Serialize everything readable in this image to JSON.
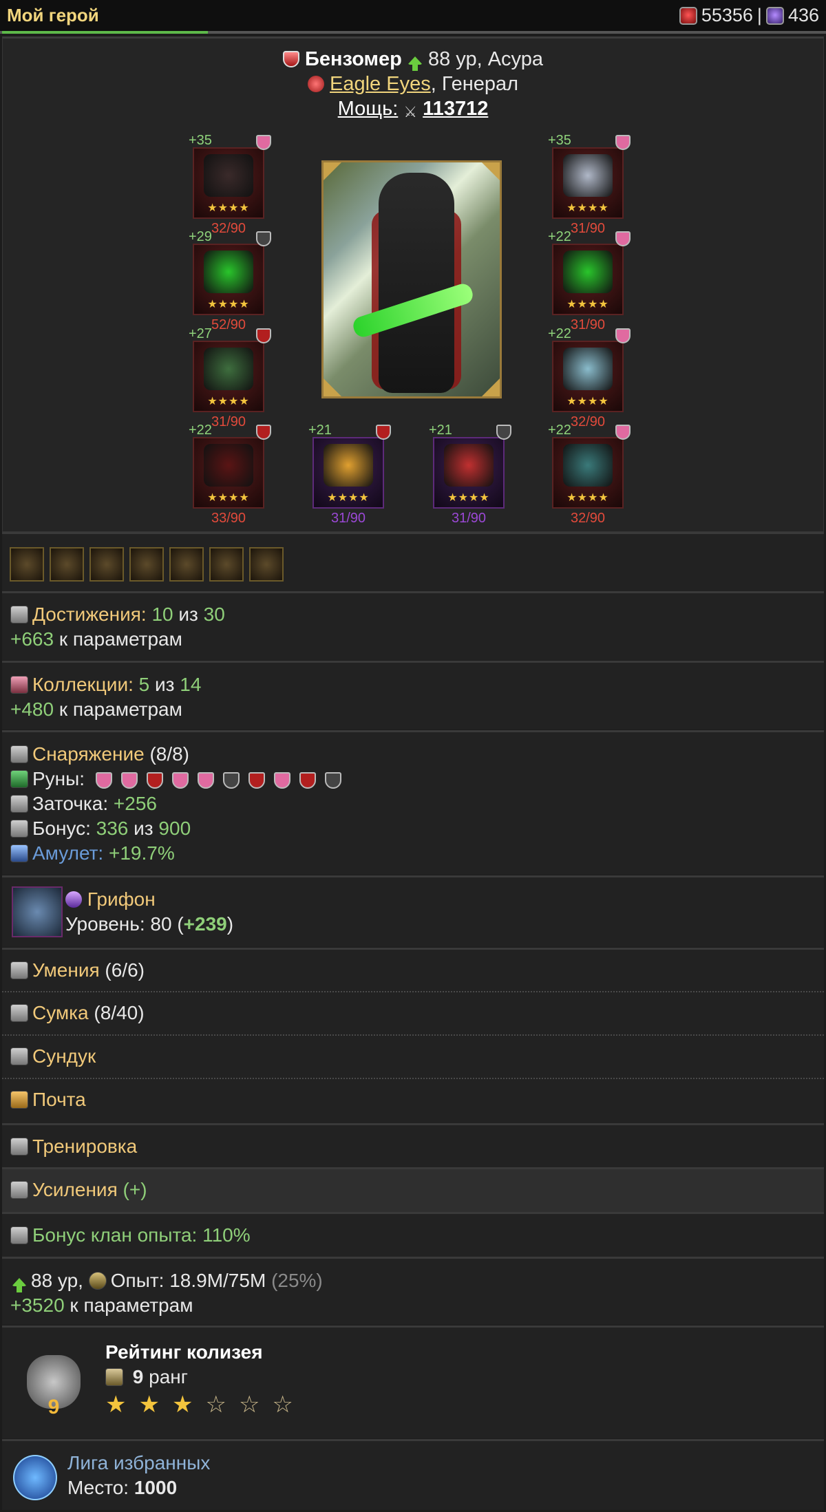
{
  "topbar": {
    "title": "Мой герой",
    "red_amount": "55356",
    "separator": "|",
    "purple_amount": "436"
  },
  "hero": {
    "name": "Бензомер",
    "level_race": "88 ур, Асура",
    "clan": "Eagle Eyes",
    "rank": ", Генерал",
    "power_label": "Мощь:",
    "power_value": "113712"
  },
  "equipment": [
    {
      "plus": "+35",
      "count": "32/90",
      "stars": "★★★★"
    },
    {
      "plus": "+35",
      "count": "31/90",
      "stars": "★★★★"
    },
    {
      "plus": "+29",
      "count": "52/90",
      "stars": "★★★★"
    },
    {
      "plus": "+22",
      "count": "31/90",
      "stars": "★★★★"
    },
    {
      "plus": "+27",
      "count": "31/90",
      "stars": "★★★★"
    },
    {
      "plus": "+22",
      "count": "32/90",
      "stars": "★★★★"
    },
    {
      "plus": "+22",
      "count": "33/90",
      "stars": "★★★★"
    },
    {
      "plus": "+21",
      "count": "31/90",
      "stars": "★★★★"
    },
    {
      "plus": "+21",
      "count": "31/90",
      "stars": "★★★★"
    },
    {
      "plus": "+22",
      "count": "32/90",
      "stars": "★★★★"
    }
  ],
  "achievements": {
    "label": "Достижения:",
    "have": "10",
    "of": "из",
    "total": "30",
    "bonus": "+663",
    "bonus_text": "к параметрам"
  },
  "collections": {
    "label": "Коллекции:",
    "have": "5",
    "of": "из",
    "total": "14",
    "bonus": "+480",
    "bonus_text": "к параметрам"
  },
  "gear": {
    "label": "Снаряжение",
    "count": "(8/8)",
    "runes_label": "Руны:",
    "sharpen_label": "Заточка:",
    "sharpen_value": "+256",
    "bonus_label": "Бонус:",
    "bonus_have": "336",
    "bonus_of": "из",
    "bonus_total": "900",
    "amulet_label": "Амулет:",
    "amulet_value": "+19.7%"
  },
  "pet": {
    "name": "Грифон",
    "level_label": "Уровень: 80 (",
    "level_bonus": "+239",
    "level_close": ")"
  },
  "skills": {
    "label": "Умения",
    "count": "(6/6)"
  },
  "bag": {
    "label": "Сумка",
    "count": "(8/40)"
  },
  "chest": {
    "label": "Сундук"
  },
  "mail": {
    "label": "Почта"
  },
  "training": {
    "label": "Тренировка"
  },
  "boosts": {
    "label": "Усиления",
    "plus": "(+)"
  },
  "clan_bonus": {
    "label": "Бонус клан опыта: 110%"
  },
  "level": {
    "level": "88 ур,",
    "exp_label": "Опыт: 18.9M/75M",
    "exp_pct": "(25%)",
    "bonus": "+3520",
    "bonus_text": "к параметрам"
  },
  "colosseum": {
    "title": "Рейтинг колизея",
    "rank_num": "9",
    "rank_text": "ранг",
    "badge_num": "9",
    "stars_full": 3,
    "stars_total": 6
  },
  "league": {
    "title": "Лига избранных",
    "place_label": "Место:",
    "place_value": "1000"
  },
  "colors": {
    "gold": "#f1c97a",
    "green": "#8fcf79",
    "blue": "#6a9bd8",
    "red_count": "#e24a3b",
    "purple_count": "#9b48d6"
  }
}
